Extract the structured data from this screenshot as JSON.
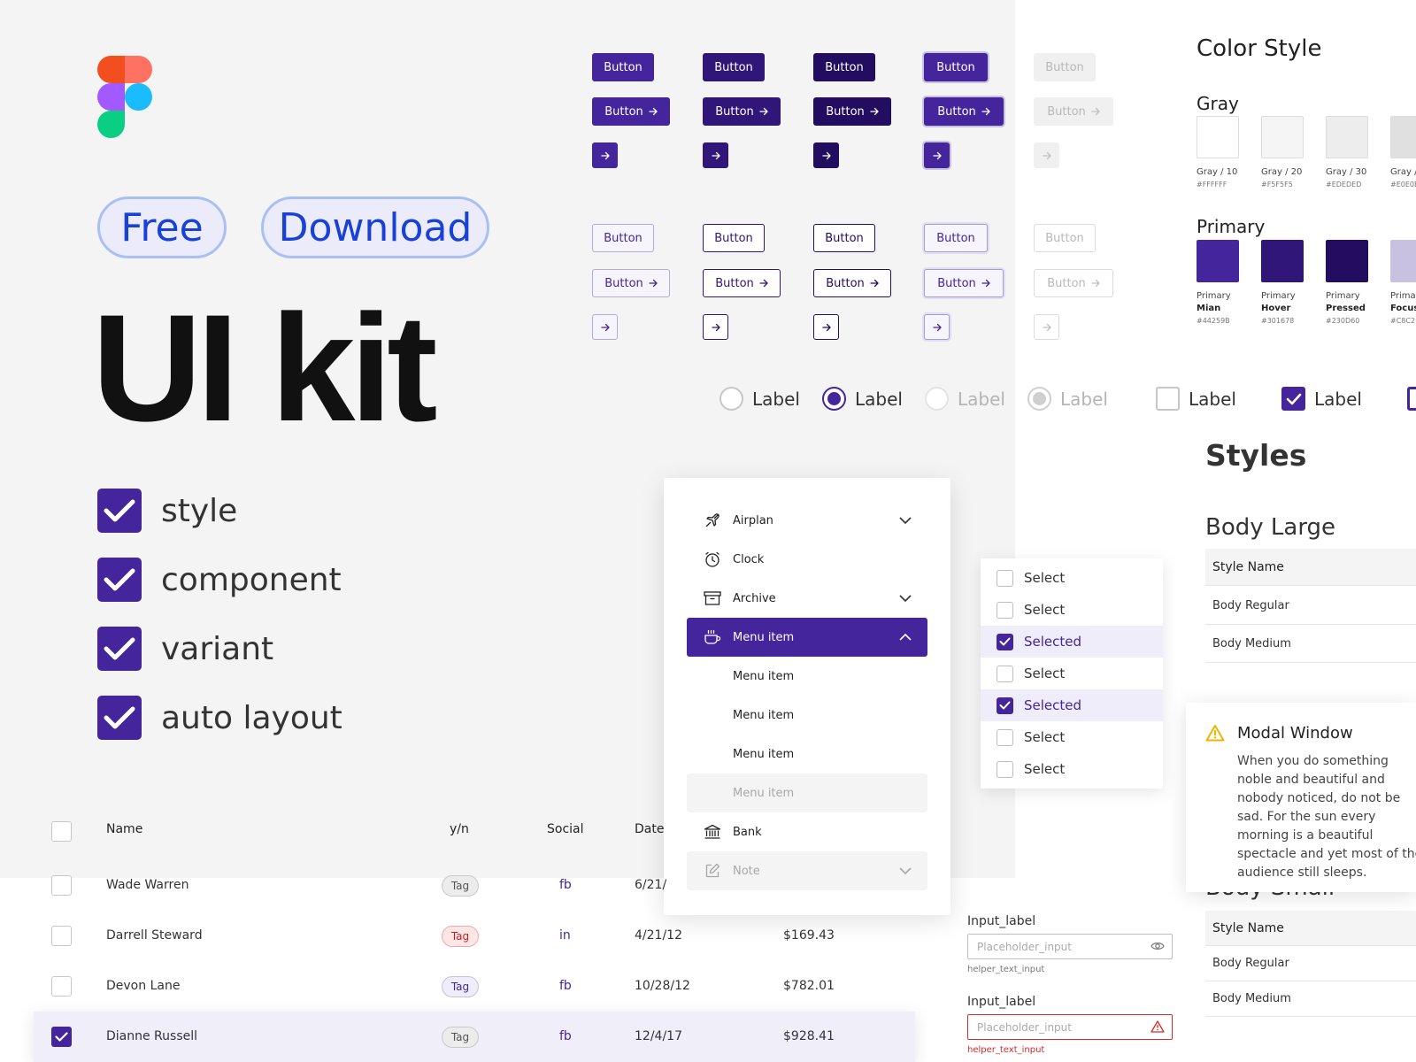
{
  "hero": {
    "pill_free": "Free",
    "pill_download": "Download",
    "title": "UI kit",
    "features": [
      "style",
      "component",
      "variant",
      "auto layout"
    ]
  },
  "buttons": {
    "label": "Button",
    "states": [
      "main",
      "hover",
      "pressed",
      "focus",
      "disabled"
    ]
  },
  "choice_labels": {
    "radio_1": "Label",
    "radio_2": "Label",
    "radio_3": "Label",
    "radio_4": "Label",
    "checkbox_1": "Label",
    "checkbox_2": "Label"
  },
  "color_style": {
    "title": "Color Style",
    "gray_title": "Gray",
    "gray": [
      {
        "name": "Gray / 10",
        "hex": "#FFFFFF",
        "color": "#FFFFFF"
      },
      {
        "name": "Gray / 20",
        "hex": "#F5F5F5",
        "color": "#F5F5F5"
      },
      {
        "name": "Gray / 30",
        "hex": "#EDEDED",
        "color": "#EDEDED"
      },
      {
        "name": "Gray /",
        "hex": "#E0E0E",
        "color": "#E0E0E0"
      }
    ],
    "primary_title": "Primary",
    "primary": [
      {
        "name": "Primary",
        "state": "Mian",
        "hex": "#44259B",
        "color": "#44259B"
      },
      {
        "name": "Primary",
        "state": "Hover",
        "hex": "#301678",
        "color": "#301678"
      },
      {
        "name": "Primary",
        "state": "Pressed",
        "hex": "#230D60",
        "color": "#230D60"
      },
      {
        "name": "Primar",
        "state": "Focus",
        "hex": "#C8C2",
        "color": "#C8C2E0"
      }
    ]
  },
  "styles": {
    "title": "Styles",
    "body_large": "Body Large",
    "body_small": "Body Small",
    "table_header": "Style Name",
    "rows": [
      "Body Regular",
      "Body Medium"
    ],
    "rows_small": [
      "Body Regular",
      "Body Medium"
    ],
    "table_header_small": "Style Name"
  },
  "modal": {
    "title": "Modal Window",
    "body": "When you do something noble and beautiful and nobody noticed, do not be sad. For the sun every morning is a beautiful spectacle and yet most of the audience still sleeps."
  },
  "menu": {
    "items": [
      {
        "label": "Airplan",
        "icon": "airplane-icon",
        "chevron": "down"
      },
      {
        "label": "Clock",
        "icon": "clock-icon"
      },
      {
        "label": "Archive",
        "icon": "archive-icon",
        "chevron": "down"
      },
      {
        "label": "Menu item",
        "icon": "coffee-icon",
        "chevron": "up",
        "active": true
      },
      {
        "label": "Menu item"
      },
      {
        "label": "Menu item"
      },
      {
        "label": "Menu item"
      },
      {
        "label": "Menu item",
        "disabled": true
      },
      {
        "label": "Bank",
        "icon": "bank-icon"
      },
      {
        "label": "Note",
        "icon": "note-icon",
        "chevron": "down",
        "disabled": true
      }
    ]
  },
  "select_list": {
    "items": [
      {
        "label": "Select",
        "checked": false
      },
      {
        "label": "Select",
        "checked": false
      },
      {
        "label": "Selected",
        "checked": true
      },
      {
        "label": "Select",
        "checked": false
      },
      {
        "label": "Selected",
        "checked": true
      },
      {
        "label": "Select",
        "checked": false
      },
      {
        "label": "Select",
        "checked": false
      }
    ]
  },
  "inputs": [
    {
      "label": "Input_label",
      "placeholder": "Placeholder_input",
      "helper": "helper_text_input",
      "state": "default"
    },
    {
      "label": "Input_label",
      "placeholder": "Placeholder_input",
      "helper": "helper_text_input",
      "state": "error"
    }
  ],
  "table": {
    "headers": {
      "name": "Name",
      "yn": "y/n",
      "social": "Social",
      "date": "Date"
    },
    "rows": [
      {
        "name": "Wade Warren",
        "tag": "Tag",
        "tag_style": "gray",
        "social": "fb",
        "date": "6/21/",
        "amount": "",
        "checked": false
      },
      {
        "name": "Darrell Steward",
        "tag": "Tag",
        "tag_style": "red",
        "social": "in",
        "date": "4/21/12",
        "amount": "$169.43",
        "checked": false
      },
      {
        "name": "Devon Lane",
        "tag": "Tag",
        "tag_style": "purple",
        "social": "fb",
        "date": "10/28/12",
        "amount": "$782.01",
        "checked": false
      },
      {
        "name": "Dianne Russell",
        "tag": "Tag",
        "tag_style": "gray",
        "social": "fb",
        "date": "12/4/17",
        "amount": "$928.41",
        "checked": true
      }
    ]
  },
  "colors": {
    "primary": "#44259B",
    "primary_hover": "#301678",
    "primary_pressed": "#230D60",
    "primary_focus": "#C8C2E0",
    "error": "#D42A2A",
    "pill_text": "#1841D8"
  }
}
